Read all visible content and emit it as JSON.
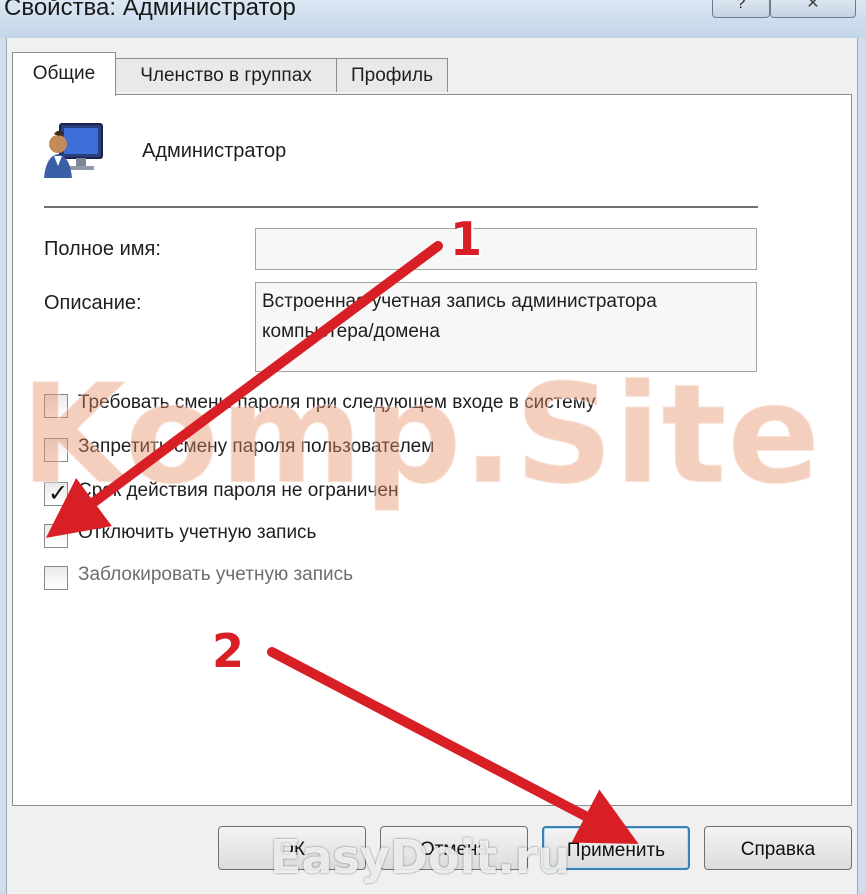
{
  "window": {
    "title": "Свойства: Администратор",
    "help_button": "?",
    "close_button": "✕"
  },
  "tabs": [
    {
      "label": "Общие",
      "active": true
    },
    {
      "label": "Членство в группах",
      "active": false
    },
    {
      "label": "Профиль",
      "active": false
    }
  ],
  "user": {
    "icon": "user-computer-icon",
    "name": "Администратор"
  },
  "fields": {
    "full_name_label": "Полное имя:",
    "full_name_value": "",
    "description_label": "Описание:",
    "description_value": "Встроенная учетная запись администратора компьютера/домена"
  },
  "checkboxes": [
    {
      "label": "Требовать смены пароля при следующем входе в систему",
      "checked": false,
      "enabled": true
    },
    {
      "label": "Запретить смену пароля пользователем",
      "checked": false,
      "enabled": true
    },
    {
      "label": "Срок действия пароля не ограничен",
      "checked": true,
      "enabled": true
    },
    {
      "label": "Отключить учетную запись",
      "checked": false,
      "enabled": true
    },
    {
      "label": "Заблокировать учетную запись",
      "checked": false,
      "enabled": false
    }
  ],
  "buttons": {
    "ok": "ОК",
    "cancel": "Отмена",
    "apply": "Применить",
    "help": "Справка"
  },
  "watermarks": {
    "center": "Komp.Site",
    "bottom": "EasyDoit.ru"
  },
  "annotations": {
    "callout_1": "1",
    "callout_2": "2",
    "arrow_color": "#d81f26"
  }
}
